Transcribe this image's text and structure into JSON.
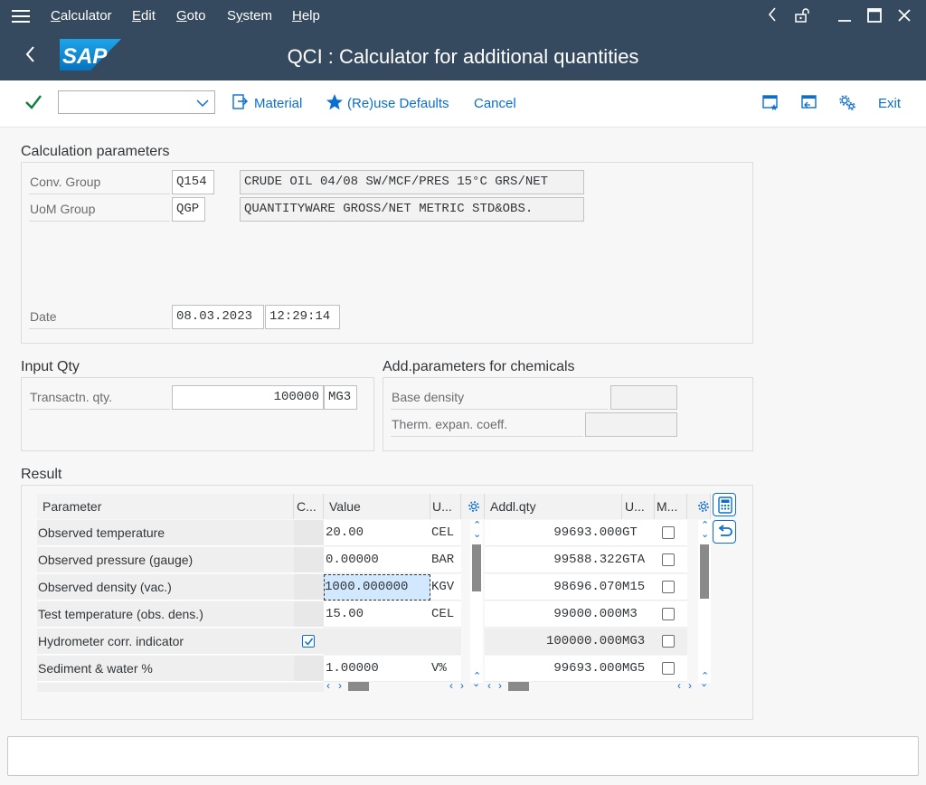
{
  "menubar": {
    "items": [
      {
        "label": "Calculator",
        "accel": "C"
      },
      {
        "label": "Edit",
        "accel": "E"
      },
      {
        "label": "Goto",
        "accel": "G"
      },
      {
        "label": "System",
        "accel": "y"
      },
      {
        "label": "Help",
        "accel": "H"
      }
    ]
  },
  "title": "QCI : Calculator for additional quantities",
  "logo_text": "SAP",
  "toolbar": {
    "command_field_value": "",
    "material_label": "Material",
    "reuse_defaults_label": "(Re)use Defaults",
    "cancel_label": "Cancel",
    "exit_label": "Exit"
  },
  "calc_params": {
    "title": "Calculation parameters",
    "conv_group_label": "Conv. Group",
    "conv_group_value": "Q154",
    "conv_group_desc": "CRUDE OIL 04/08 SW/MCF/PRES 15°C GRS/NET",
    "uom_group_label": "UoM Group",
    "uom_group_value": "QGP",
    "uom_group_desc": "QUANTITYWARE GROSS/NET METRIC STD&OBS.",
    "date_label": "Date",
    "date_value": "08.03.2023",
    "time_value": "12:29:14"
  },
  "input_qty": {
    "title": "Input Qty",
    "transactn_label": "Transactn. qty.",
    "transactn_value": "100000",
    "transactn_unit": "MG3"
  },
  "chem_params": {
    "title": "Add.parameters for chemicals",
    "base_density_label": "Base density",
    "base_density_value": "",
    "therm_label": "Therm. expan. coeff.",
    "therm_value": ""
  },
  "result": {
    "title": "Result",
    "left_headers": {
      "parameter": "Parameter",
      "c": "C...",
      "value": "Value",
      "unit": "U..."
    },
    "right_headers": {
      "addl_qty": "Addl.qty",
      "unit": "U...",
      "m": "M..."
    },
    "left_rows": [
      {
        "parameter": "Observed temperature",
        "checked": false,
        "value": "20.00",
        "unit": "CEL"
      },
      {
        "parameter": "Observed pressure (gauge)",
        "checked": false,
        "value": "0.00000",
        "unit": "BAR"
      },
      {
        "parameter": "Observed density (vac.)",
        "checked": false,
        "value": "1000.000000",
        "unit": "KGV"
      },
      {
        "parameter": "Test temperature (obs. dens.)",
        "checked": false,
        "value": "15.00",
        "unit": "CEL"
      },
      {
        "parameter": "Hydrometer corr. indicator",
        "checked": true,
        "value": "",
        "unit": ""
      },
      {
        "parameter": "Sediment & water %",
        "checked": false,
        "value": "1.00000",
        "unit": "V%"
      }
    ],
    "right_rows": [
      {
        "qty": "99693.000",
        "unit": "GT",
        "checked": false
      },
      {
        "qty": "99588.322",
        "unit": "GTA",
        "checked": false
      },
      {
        "qty": "98696.070",
        "unit": "M15",
        "checked": false
      },
      {
        "qty": "99000.000",
        "unit": "M3",
        "checked": false
      },
      {
        "qty": "100000.000",
        "unit": "MG3",
        "checked": false
      },
      {
        "qty": "99693.000",
        "unit": "MG5",
        "checked": false
      }
    ]
  },
  "colors": {
    "shell": "#354a5f",
    "accent": "#0a6ed1",
    "ok_green": "#107e3e",
    "selection": "#d1e8ff"
  }
}
